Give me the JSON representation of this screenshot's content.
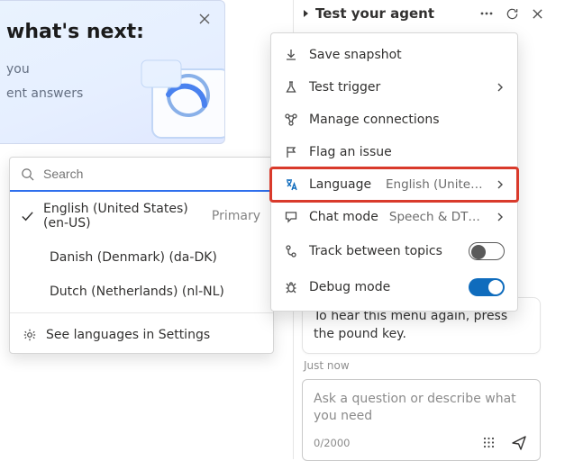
{
  "welcome": {
    "title": "what's next:",
    "line1": "you",
    "line2": "ent answers"
  },
  "lang_flyout": {
    "search_placeholder": "Search",
    "items": [
      {
        "label": "English (United States) (en-US)",
        "primary": "Primary",
        "checked": true
      },
      {
        "label": "Danish (Denmark) (da-DK)",
        "primary": "",
        "checked": false
      },
      {
        "label": "Dutch (Netherlands) (nl-NL)",
        "primary": "",
        "checked": false
      }
    ],
    "settings": "See languages in Settings"
  },
  "panel": {
    "title": "Test your agent"
  },
  "menu": {
    "save_snapshot": "Save snapshot",
    "test_trigger": "Test trigger",
    "manage_connections": "Manage connections",
    "flag_issue": "Flag an issue",
    "language_label": "Language",
    "language_value": "English (United …",
    "chat_mode_label": "Chat mode",
    "chat_mode_value": "Speech & DTMF",
    "track_between": "Track between topics",
    "debug_mode": "Debug mode"
  },
  "chat": {
    "bubble": "To hear this menu again, press the pound key.",
    "timestamp": "Just now",
    "placeholder": "Ask a question or describe what you need",
    "charcount": "0/2000"
  }
}
